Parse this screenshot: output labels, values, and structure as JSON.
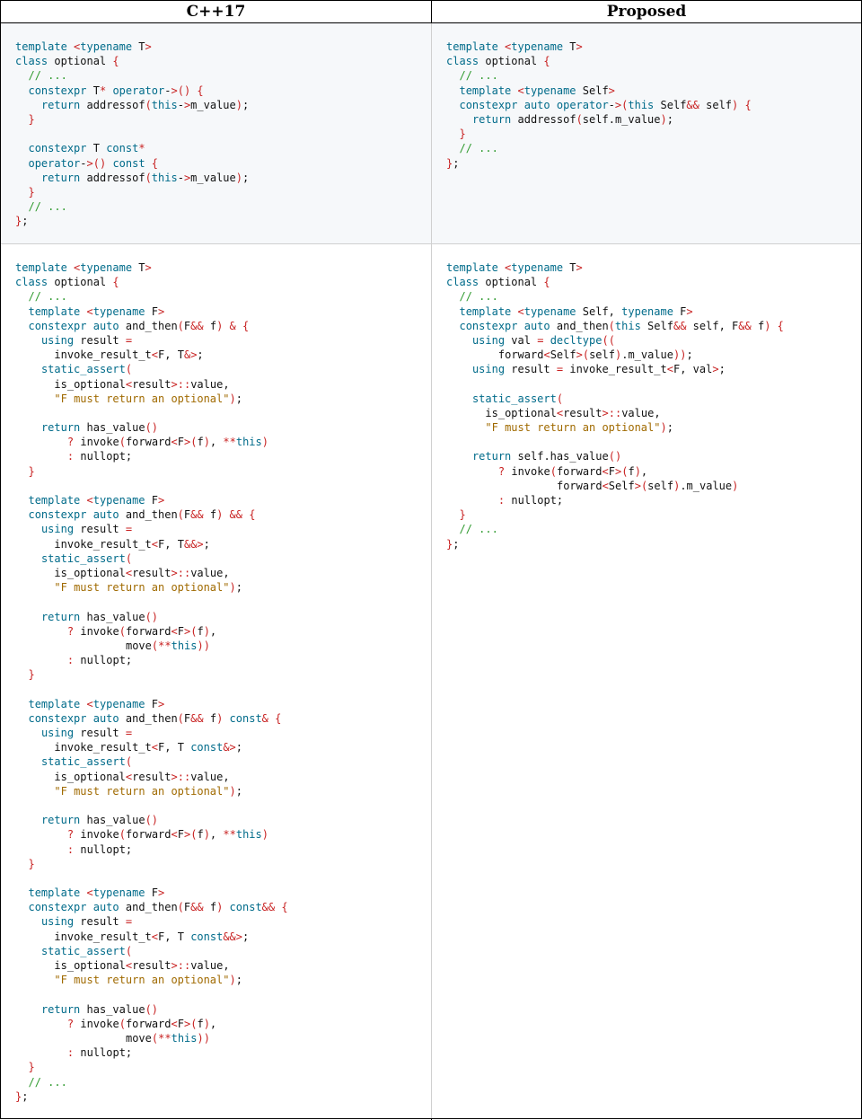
{
  "headers": {
    "left": "C++17",
    "right": "Proposed"
  },
  "rows": [
    {
      "left_code": [
        "template <typename T>",
        "class optional {",
        "  // ...",
        "  constexpr T* operator->() {",
        "    return addressof(this->m_value);",
        "  }",
        "",
        "  constexpr T const*",
        "  operator->() const {",
        "    return addressof(this->m_value);",
        "  }",
        "  // ...",
        "};"
      ],
      "right_code": [
        "template <typename T>",
        "class optional {",
        "  // ...",
        "  template <typename Self>",
        "  constexpr auto operator->(this Self&& self) {",
        "    return addressof(self.m_value);",
        "  }",
        "  // ...",
        "};"
      ]
    },
    {
      "left_code": [
        "template <typename T>",
        "class optional {",
        "  // ...",
        "  template <typename F>",
        "  constexpr auto and_then(F&& f) & {",
        "    using result =",
        "      invoke_result_t<F, T&>;",
        "    static_assert(",
        "      is_optional<result>::value,",
        "      \"F must return an optional\");",
        "",
        "    return has_value()",
        "        ? invoke(forward<F>(f), **this)",
        "        : nullopt;",
        "  }",
        "",
        "  template <typename F>",
        "  constexpr auto and_then(F&& f) && {",
        "    using result =",
        "      invoke_result_t<F, T&&>;",
        "    static_assert(",
        "      is_optional<result>::value,",
        "      \"F must return an optional\");",
        "",
        "    return has_value()",
        "        ? invoke(forward<F>(f),",
        "                 move(**this))",
        "        : nullopt;",
        "  }",
        "",
        "  template <typename F>",
        "  constexpr auto and_then(F&& f) const& {",
        "    using result =",
        "      invoke_result_t<F, T const&>;",
        "    static_assert(",
        "      is_optional<result>::value,",
        "      \"F must return an optional\");",
        "",
        "    return has_value()",
        "        ? invoke(forward<F>(f), **this)",
        "        : nullopt;",
        "  }",
        "",
        "  template <typename F>",
        "  constexpr auto and_then(F&& f) const&& {",
        "    using result =",
        "      invoke_result_t<F, T const&&>;",
        "    static_assert(",
        "      is_optional<result>::value,",
        "      \"F must return an optional\");",
        "",
        "    return has_value()",
        "        ? invoke(forward<F>(f),",
        "                 move(**this))",
        "        : nullopt;",
        "  }",
        "  // ...",
        "};"
      ],
      "right_code": [
        "template <typename T>",
        "class optional {",
        "  // ...",
        "  template <typename Self, typename F>",
        "  constexpr auto and_then(this Self&& self, F&& f) {",
        "    using val = decltype((",
        "        forward<Self>(self).m_value));",
        "    using result = invoke_result_t<F, val>;",
        "",
        "    static_assert(",
        "      is_optional<result>::value,",
        "      \"F must return an optional\");",
        "",
        "    return self.has_value()",
        "        ? invoke(forward<F>(f),",
        "                 forward<Self>(self).m_value)",
        "        : nullopt;",
        "  }",
        "  // ...",
        "};"
      ]
    }
  ]
}
